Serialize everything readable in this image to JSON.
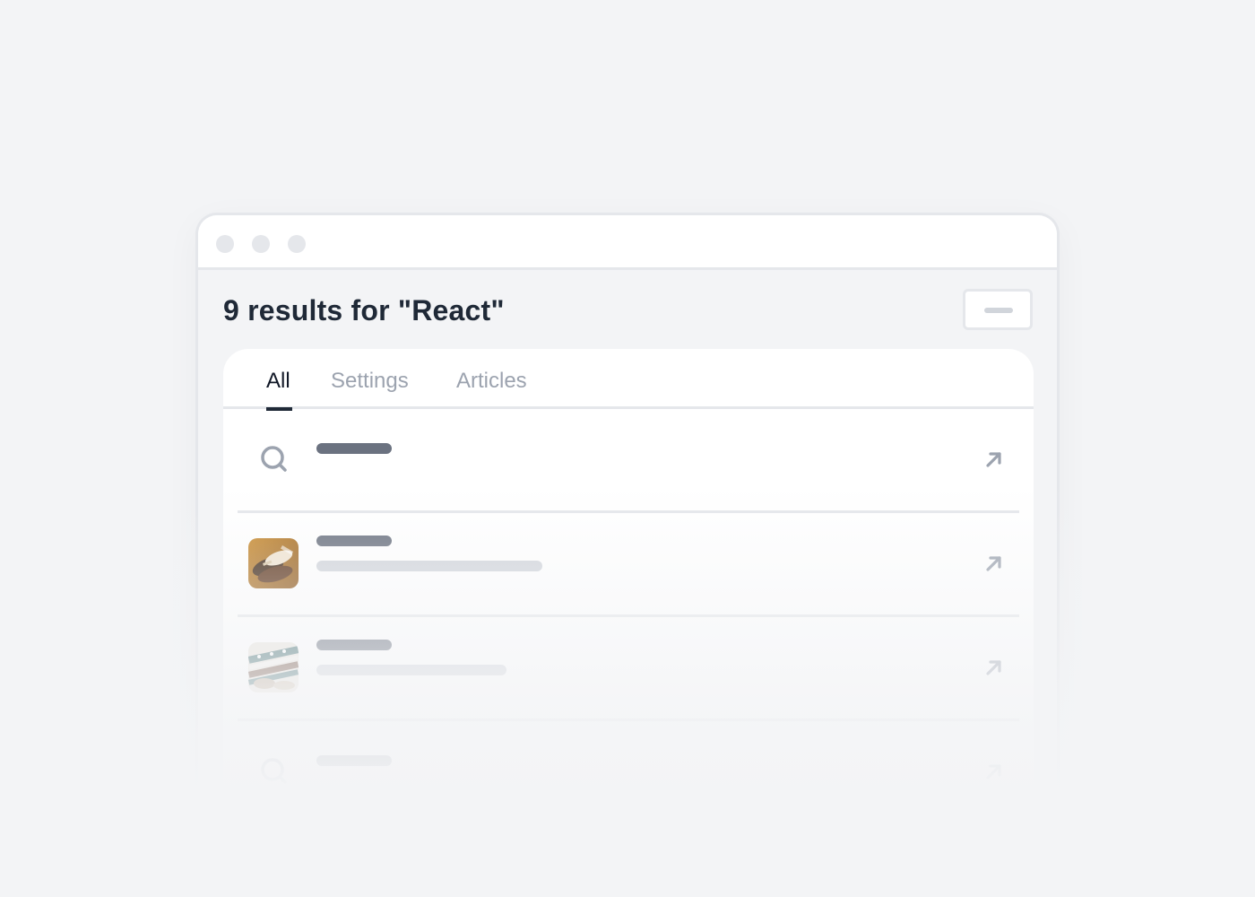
{
  "window": {
    "controls": [
      "close",
      "minimize",
      "maximize"
    ]
  },
  "header": {
    "title": "9 results for \"React\""
  },
  "tabs": [
    {
      "label": "All",
      "active": true
    },
    {
      "label": "Settings",
      "active": false
    },
    {
      "label": "Articles",
      "active": false
    }
  ],
  "results": [
    {
      "icon": "search-icon",
      "kind": "query",
      "action_icon": "arrow-up-right-icon"
    },
    {
      "icon": "thumbnail-leather-shoes",
      "kind": "product",
      "action_icon": "arrow-up-right-icon"
    },
    {
      "icon": "thumbnail-knit-sweater",
      "kind": "product",
      "action_icon": "arrow-up-right-icon"
    },
    {
      "icon": "search-icon",
      "kind": "query",
      "action_icon": "arrow-up-right-icon"
    }
  ],
  "colors": {
    "background": "#f3f4f6",
    "panel": "#ffffff",
    "border": "#e5e7eb",
    "heading_text": "#1f2937",
    "active_tab": "#111827",
    "inactive_tab": "#9ca3af",
    "placeholder_dark": "#6b7280",
    "placeholder_light": "#d1d5db",
    "icon": "#9ca3af"
  }
}
